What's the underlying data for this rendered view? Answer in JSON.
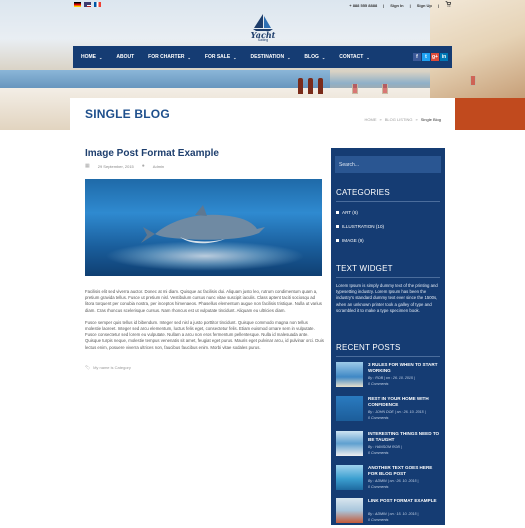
{
  "topbar": {
    "phone": "+ 888 555 8888",
    "sign_in": "Sign In",
    "sign_up": "Sign Up",
    "cart_icon": "cart-icon"
  },
  "logo": {
    "name": "Yacht",
    "tagline": "Sailing"
  },
  "nav": {
    "items": [
      {
        "label": "HOME",
        "has_dropdown": true
      },
      {
        "label": "ABOUT",
        "has_dropdown": false
      },
      {
        "label": "FOR CHARTER",
        "has_dropdown": true
      },
      {
        "label": "FOR SALE",
        "has_dropdown": true
      },
      {
        "label": "DESTINATION",
        "has_dropdown": true
      },
      {
        "label": "BLOG",
        "has_dropdown": true
      },
      {
        "label": "CONTACT",
        "has_dropdown": true
      }
    ],
    "social": [
      "f",
      "t",
      "g+",
      "in"
    ]
  },
  "page": {
    "title": "SINGLE BLOG",
    "breadcrumb": [
      "HOME",
      "BLOG LISTING",
      "Single Blog"
    ]
  },
  "post": {
    "title": "Image Post Format Example",
    "date": "29 September, 2015",
    "author": "Admin",
    "para1": "Facilisis elit sed viverra auctor. Donec at mi diam. Quisque ac facilisis dui. Aliquam justo leo, rutrum condimentum quam a, pretium gravida tellus. Fusce ut pretium nisl. Vestibulum cursus nunc vitae suscipit iaculis. Class aptent taciti sociosqu ad litora torquent per conubia nostra, per inceptos himenaeos. Phasellus elementum augue non facilisis tristique. Nulla ut varius diam. Cras rhoncus scelerisque cursus. Nam rhoncus est ut vulputate tincidunt. Aliquam eu ultricies diam.",
    "para2": "Fusce semper quis tellus id bibendum. Integer sed nisl a justo porttitor tincidunt. Quisque commodo magna non tellus molestie laoreet. Integer sed arcu elementum, luctus felis eget, consectetur felis. Etiam euismod ornare sem in vulputate. Fusce consectetur sed lorem eu vulputate. Nullam a arcu non eros fermentum pellentesque. Nulla id malesuada ante. Quisque turpis neque, molestie tempus venenatis sit amet, feugiat eget purus. Mauris eget pulvinar arcu, id pulvinar orci. Duis lectus enim, posuere viverra ultrices non, faucibus faucibus enim. Morbi vitae sodales purus.",
    "tags": "My name is Category"
  },
  "sidebar": {
    "search_placeholder": "Search...",
    "categories_title": "CATEGORIES",
    "categories": [
      {
        "label": "ART (6)"
      },
      {
        "label": "ILLUSTRATION (10)"
      },
      {
        "label": "IMAGE (9)"
      }
    ],
    "text_widget_title": "TEXT WIDGET",
    "text_widget_body": "Lorem Ipsum is simply dummy text of the printing and typesetting industry. Lorem Ipsum has been the industry's standard dummy text ever since the 1500s, when an unknown printer took a galley of type and scrambled it to make a type specimen book.",
    "recent_title": "RECENT POSTS",
    "recent": [
      {
        "title": "3 RULES FOR WHEN TO START WORKING",
        "meta": "By : ROB  |  on : 26. 10. 2015  |",
        "comments": "0 Comments"
      },
      {
        "title": "REST IN YOUR HOME WITH CONFIDENCE",
        "meta": "By : JOHN DOE  |  on : 26. 10. 2015  |",
        "comments": "0 Comments"
      },
      {
        "title": "INTERESTING THINGS NEED TO BE TAUGHT",
        "meta": "By : HANSOM ROB  |",
        "comments": "0 Comments"
      },
      {
        "title": "ANOTHER TEXT GOES HERE FOR BLOG POST",
        "meta": "By : ADMIN  |  on : 26. 10. 2015  |",
        "comments": "0 Comments"
      },
      {
        "title": "LINK POST FORMAT EXAMPLE",
        "meta": "By : ADMIN  |  on : 15. 10. 2015  |",
        "comments": "0 Comments"
      }
    ]
  },
  "colors": {
    "primary": "#153c73",
    "title_blue": "#1e4f8c"
  }
}
